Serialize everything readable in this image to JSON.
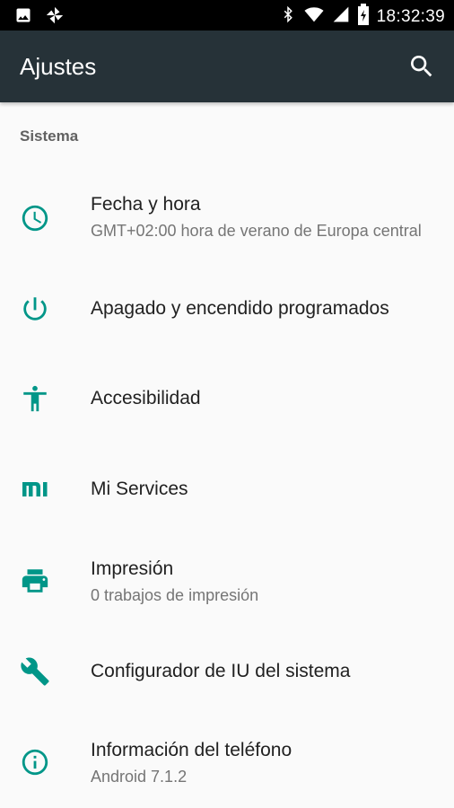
{
  "status_bar": {
    "time": "18:32:39",
    "left_icons": [
      "image-icon",
      "pinwheel-icon"
    ],
    "right_icons": [
      "bluetooth-icon",
      "wifi-icon",
      "signal-icon",
      "battery-icon"
    ]
  },
  "app_bar": {
    "title": "Ajustes",
    "search_icon": "search-icon"
  },
  "section": {
    "title": "Sistema"
  },
  "colors": {
    "accent": "#009688",
    "app_bar": "#263238",
    "background": "#fafafa"
  },
  "items": [
    {
      "label": "Fecha y hora",
      "summary": "GMT+02:00 hora de verano de Europa central",
      "icon": "clock-icon"
    },
    {
      "label": "Apagado y encendido programados",
      "summary": "",
      "icon": "power-icon"
    },
    {
      "label": "Accesibilidad",
      "summary": "",
      "icon": "accessibility-icon"
    },
    {
      "label": "Mi Services",
      "summary": "",
      "icon": "mi-logo-icon"
    },
    {
      "label": "Impresión",
      "summary": "0 trabajos de impresión",
      "icon": "printer-icon"
    },
    {
      "label": "Configurador de IU del sistema",
      "summary": "",
      "icon": "wrench-icon"
    },
    {
      "label": "Información del teléfono",
      "summary": "Android 7.1.2",
      "icon": "info-icon"
    }
  ]
}
